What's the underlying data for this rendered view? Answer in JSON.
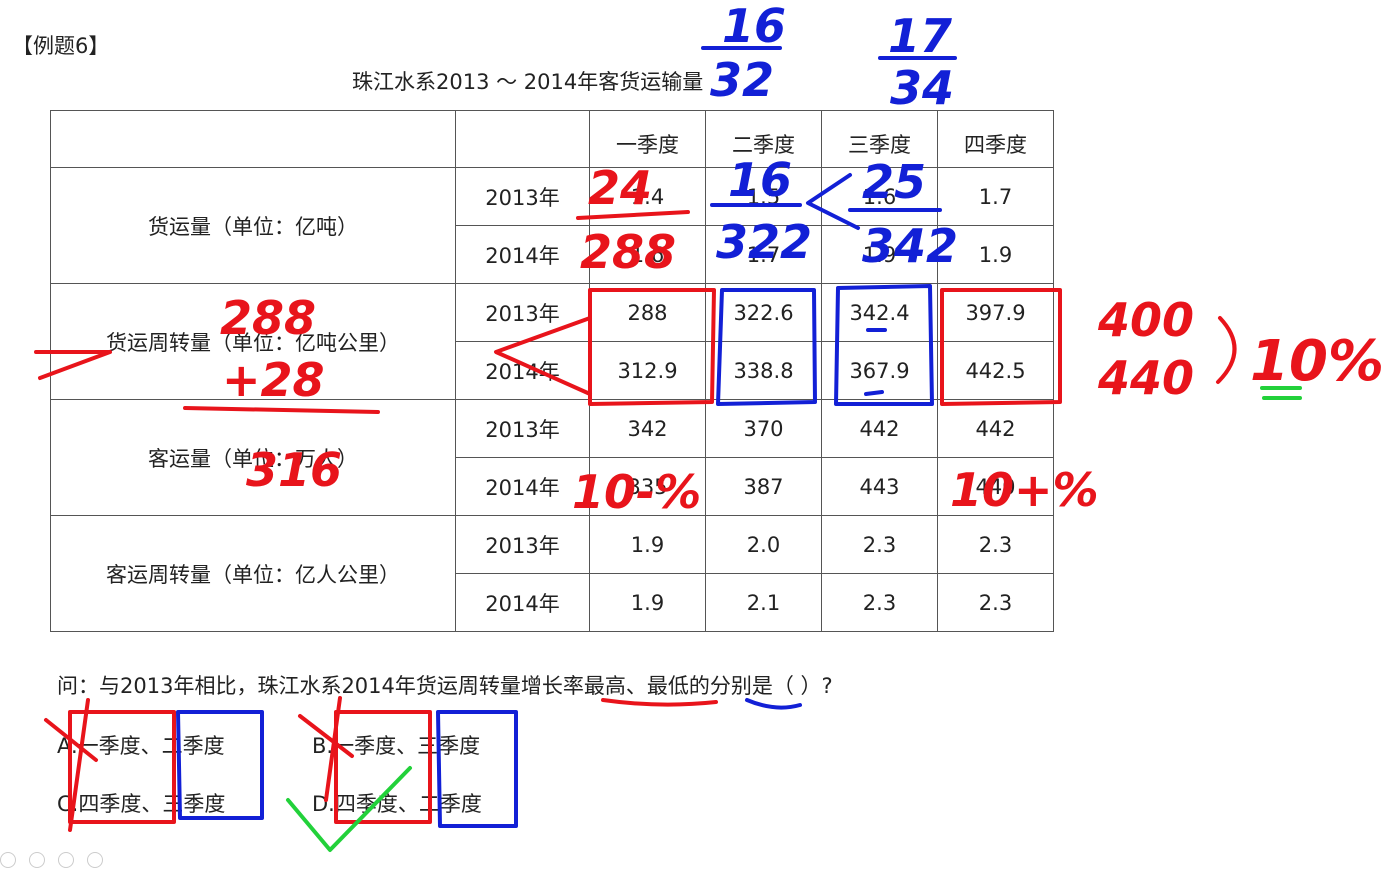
{
  "example_label": "【例题6】",
  "table": {
    "title": "珠江水系2013 ～ 2014年客货运输量",
    "quarters": [
      "一季度",
      "二季度",
      "三季度",
      "四季度"
    ],
    "groups": [
      {
        "label": "货运量（单位：亿吨）",
        "rows": [
          {
            "year": "2013年",
            "values": [
              "1.4",
              "1.5",
              "1.6",
              "1.7"
            ]
          },
          {
            "year": "2014年",
            "values": [
              "1.6",
              "1.7",
              "1.9",
              "1.9"
            ]
          }
        ]
      },
      {
        "label": "货运周转量（单位：亿吨公里）",
        "rows": [
          {
            "year": "2013年",
            "values": [
              "288",
              "322.6",
              "342.4",
              "397.9"
            ]
          },
          {
            "year": "2014年",
            "values": [
              "312.9",
              "338.8",
              "367.9",
              "442.5"
            ]
          }
        ]
      },
      {
        "label": "客运量（单位：万人）",
        "rows": [
          {
            "year": "2013年",
            "values": [
              "342",
              "370",
              "442",
              "442"
            ]
          },
          {
            "year": "2014年",
            "values": [
              "335",
              "387",
              "443",
              "440"
            ]
          }
        ]
      },
      {
        "label": "客运周转量（单位：亿人公里）",
        "rows": [
          {
            "year": "2013年",
            "values": [
              "1.9",
              "2.0",
              "2.3",
              "2.3"
            ]
          },
          {
            "year": "2014年",
            "values": [
              "1.9",
              "2.1",
              "2.3",
              "2.3"
            ]
          }
        ]
      }
    ]
  },
  "question": "问：与2013年相比，珠江水系2014年货运周转量增长率最高、最低的分别是（  ）?",
  "options": {
    "a": "A.一季度、二季度",
    "b": "B.一季度、三季度",
    "c": "C.四季度、三季度",
    "d": "D.四季度、二季度"
  },
  "annotations": {
    "top_frac_1_num": "16",
    "top_frac_1_den": "32",
    "top_frac_2_num": "17",
    "top_frac_2_den": "34",
    "q1_num": "24",
    "q1_den": "288",
    "q2_num": "16",
    "q2_den": "322",
    "q3_num": "25",
    "q3_den": "342",
    "sum_line1": "288",
    "sum_line2": "+28",
    "sum_line3": "316",
    "right_1": "400",
    "right_2": "440",
    "right_pct": "10%",
    "pct_left": "10-%",
    "pct_right": "10+%",
    "ink_red": "#e8141b",
    "ink_blue": "#1220d6",
    "ink_green": "#22d13a"
  }
}
